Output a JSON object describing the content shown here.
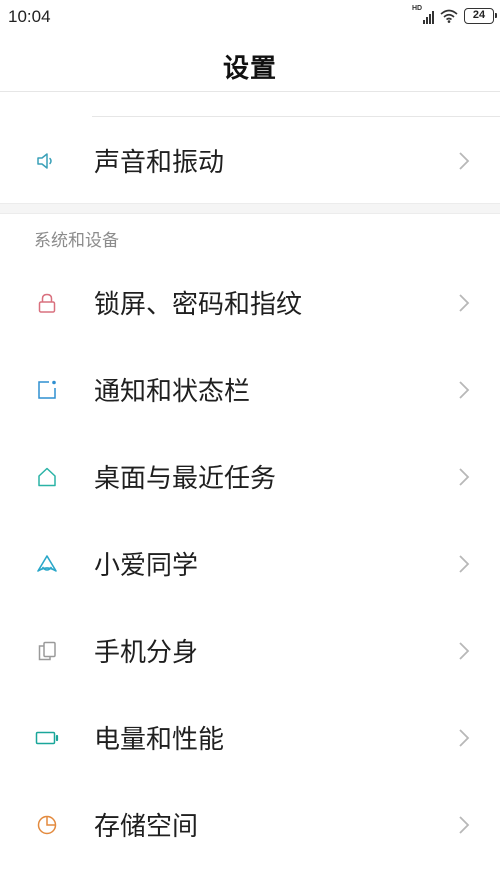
{
  "status_bar": {
    "time": "10:04",
    "network_label": "HD",
    "battery_level": "24",
    "icons": [
      "signal-icon",
      "wifi-icon",
      "battery-icon"
    ]
  },
  "header": {
    "title": "设置"
  },
  "top_section": {
    "items": [
      {
        "label": "声音和振动",
        "icon": "speaker-icon",
        "icon_color": "#3aa0b8"
      }
    ]
  },
  "system_section": {
    "header": "系统和设备",
    "items": [
      {
        "label": "锁屏、密码和指纹",
        "icon": "lock-icon",
        "icon_color": "#d9707e"
      },
      {
        "label": "通知和状态栏",
        "icon": "notification-icon",
        "icon_color": "#2f8fd0"
      },
      {
        "label": "桌面与最近任务",
        "icon": "home-icon",
        "icon_color": "#2ab3a6"
      },
      {
        "label": "小爱同学",
        "icon": "xiaoai-icon",
        "icon_color": "#2aa7c9"
      },
      {
        "label": "手机分身",
        "icon": "dual-phone-icon",
        "icon_color": "#9a9a9a"
      },
      {
        "label": "电量和性能",
        "icon": "battery-icon",
        "icon_color": "#1aa69a"
      },
      {
        "label": "存储空间",
        "icon": "storage-pie-icon",
        "icon_color": "#e38a3e"
      }
    ]
  },
  "colors": {
    "chevron": "#b8b8b8",
    "section_header_text": "#8c8c8c",
    "divider": "#e6e6e6",
    "section_gap": "#f5f5f5"
  }
}
